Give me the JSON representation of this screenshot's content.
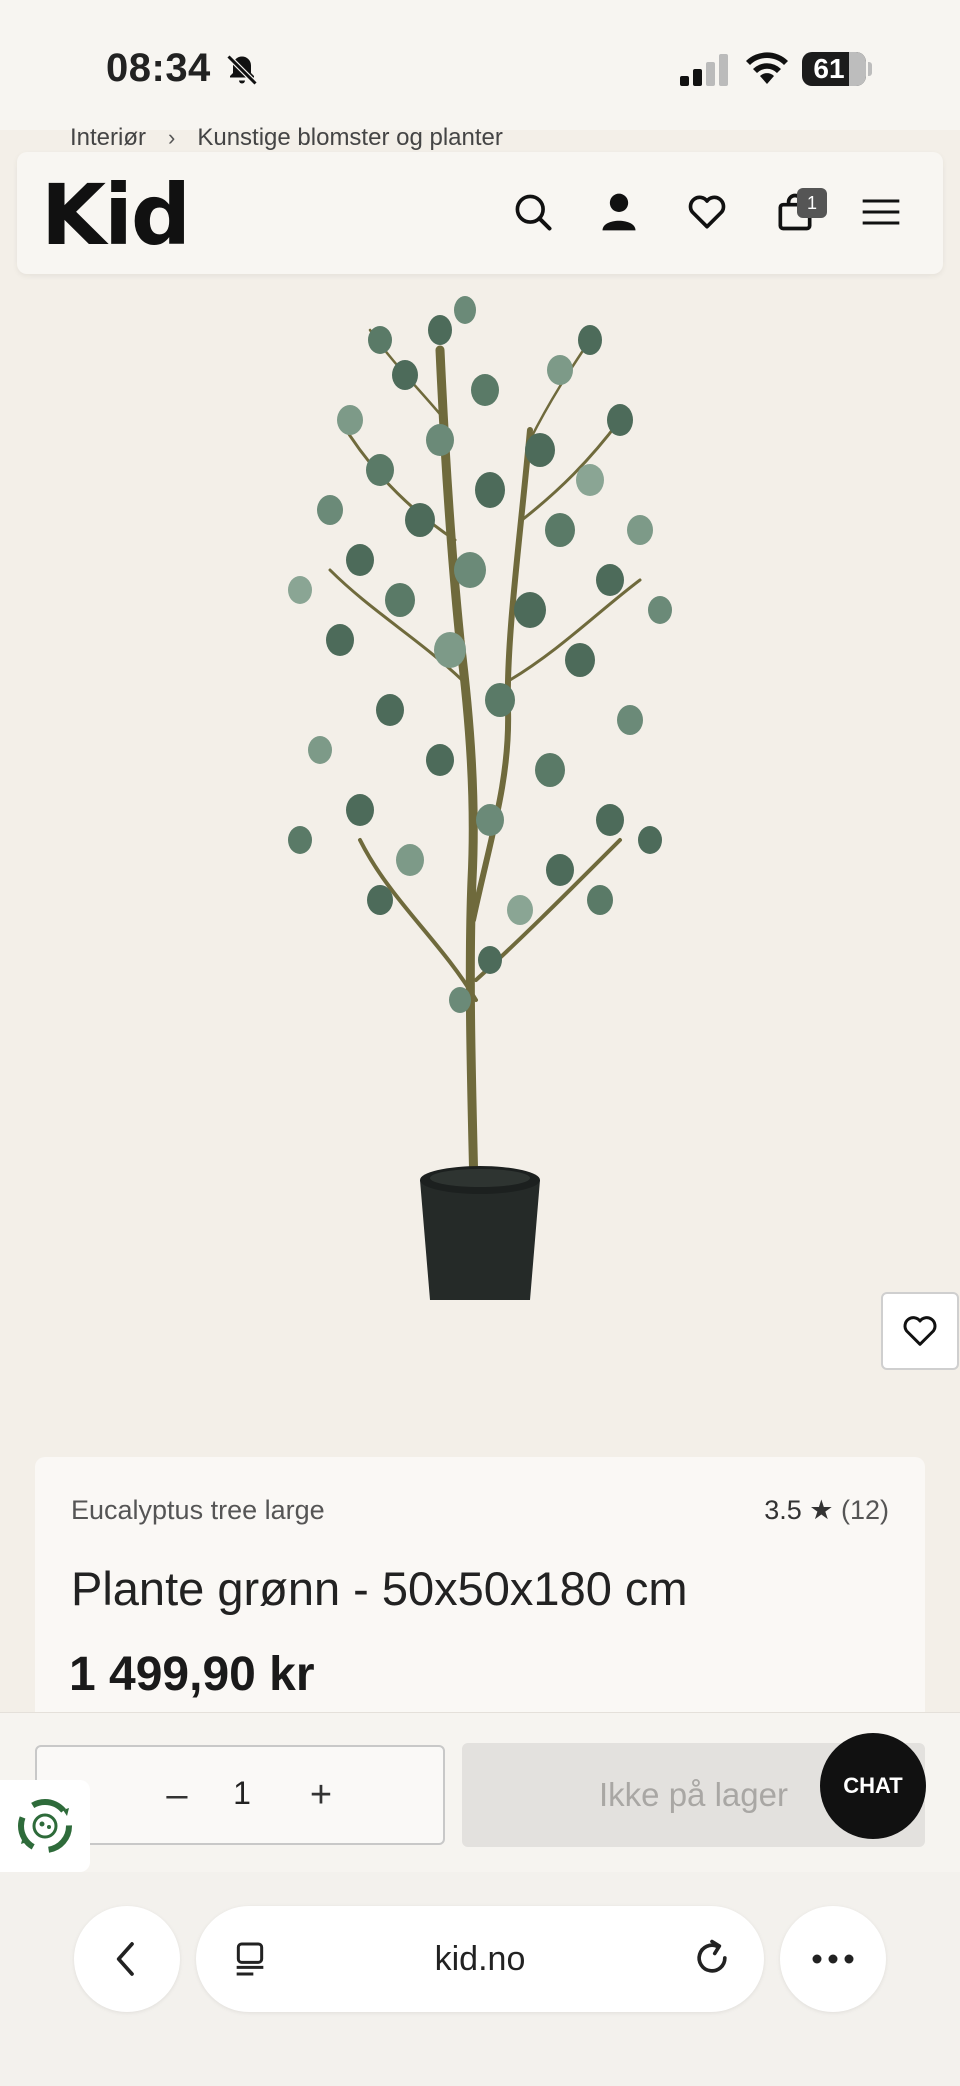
{
  "status_bar": {
    "time": "08:34",
    "battery": "61"
  },
  "breadcrumb": {
    "items": [
      "Interiør",
      "Kunstige blomster og planter"
    ],
    "separator": "›"
  },
  "header": {
    "logo": "Kid",
    "cart_count": "1"
  },
  "product": {
    "subtitle": "Eucalyptus tree large",
    "rating": "3.5 ★",
    "review_count": "(12)",
    "title": "Plante grønn - 50x50x180 cm",
    "price": "1 499,90 kr"
  },
  "buy_bar": {
    "minus": "–",
    "quantity": "1",
    "plus": "+",
    "stock_label": "Ikke på lager",
    "chat_label": "CHAT"
  },
  "browser": {
    "url": "kid.no"
  },
  "colors": {
    "accent": "#111111",
    "background": "#f3efe8",
    "disabled": "#e3e1de"
  }
}
